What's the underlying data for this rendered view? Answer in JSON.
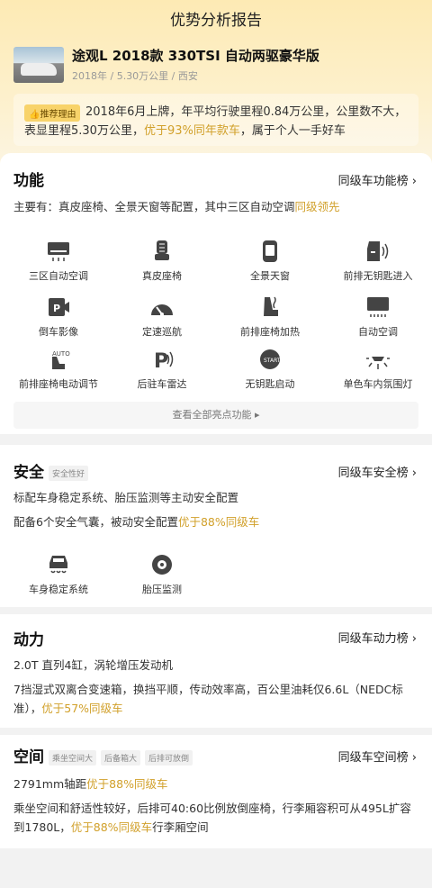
{
  "page_title": "优势分析报告",
  "car": {
    "name": "途观L 2018款 330TSI 自动两驱豪华版",
    "meta": "2018年 / 5.30万公里 / 西安"
  },
  "recommend": {
    "badge": "推荐理由",
    "text_a": "2018年6月上牌，年平均行驶里程0.84万公里，公里数不大，表显里程5.30万公里，",
    "text_highlight": "优于93%同年款车",
    "text_b": "，属于个人一手好车"
  },
  "function": {
    "title": "功能",
    "link": "同级车功能榜 ›",
    "summary_a": "主要有：真皮座椅、全景天窗等配置，其中三区自动空调",
    "summary_highlight": "同级领先",
    "features": [
      {
        "label": "三区自动空调",
        "icon": "air-conditioner-icon"
      },
      {
        "label": "真皮座椅",
        "icon": "leather-seat-icon"
      },
      {
        "label": "全景天窗",
        "icon": "panoramic-sunroof-icon"
      },
      {
        "label": "前排无钥匙进入",
        "icon": "keyless-entry-icon"
      },
      {
        "label": "倒车影像",
        "icon": "reverse-camera-icon"
      },
      {
        "label": "定速巡航",
        "icon": "cruise-control-icon"
      },
      {
        "label": "前排座椅加热",
        "icon": "seat-heating-icon"
      },
      {
        "label": "自动空调",
        "icon": "auto-ac-icon"
      },
      {
        "label": "前排座椅电动调节",
        "icon": "power-seat-icon"
      },
      {
        "label": "后驻车雷达",
        "icon": "parking-radar-icon"
      },
      {
        "label": "无钥匙启动",
        "icon": "keyless-start-icon"
      },
      {
        "label": "单色车内氛围灯",
        "icon": "ambient-light-icon"
      }
    ],
    "more": "查看全部亮点功能 ▸"
  },
  "safety": {
    "title": "安全",
    "tag": "安全性好",
    "link": "同级车安全榜 ›",
    "line1": "标配车身稳定系统、胎压监测等主动安全配置",
    "line2_a": "配备6个安全气囊，被动安全配置",
    "line2_highlight": "优于88%同级车",
    "features": [
      {
        "label": "车身稳定系统",
        "icon": "stability-control-icon"
      },
      {
        "label": "胎压监测",
        "icon": "tire-pressure-icon"
      }
    ]
  },
  "power": {
    "title": "动力",
    "link": "同级车动力榜 ›",
    "line1": "2.0T 直列4缸，涡轮增压发动机",
    "line2_a": "7挡湿式双离合变速箱，换挡平顺，传动效率高，百公里油耗仅6.6L（NEDC标准），",
    "line2_highlight": "优于57%同级车"
  },
  "space": {
    "title": "空间",
    "tags": [
      "乘坐空间大",
      "后备箱大",
      "后排可放倒"
    ],
    "link": "同级车空间榜 ›",
    "line1_a": "2791mm轴距",
    "line1_highlight": "优于88%同级车",
    "line2_a": "乘坐空间和舒适性较好，后排可40:60比例放倒座椅，行李厢容积可从495L扩容到1780L，",
    "line2_highlight": "优于88%同级车",
    "line2_b": "行李厢空间"
  },
  "colors": {
    "accent": "#d1a02a",
    "hero": "#fdeab4"
  }
}
